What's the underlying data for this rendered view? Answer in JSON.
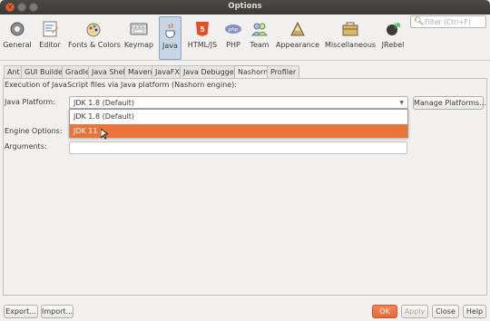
{
  "window": {
    "title": "Options"
  },
  "search": {
    "placeholder": "Filter (Ctrl+F)"
  },
  "categories": [
    {
      "label": "General",
      "icon": "general-icon"
    },
    {
      "label": "Editor",
      "icon": "editor-icon"
    },
    {
      "label": "Fonts & Colors",
      "icon": "fonts-colors-icon"
    },
    {
      "label": "Keymap",
      "icon": "keymap-icon"
    },
    {
      "label": "Java",
      "icon": "java-icon"
    },
    {
      "label": "HTML/JS",
      "icon": "html5-icon"
    },
    {
      "label": "PHP",
      "icon": "php-icon"
    },
    {
      "label": "Team",
      "icon": "team-icon"
    },
    {
      "label": "Appearance",
      "icon": "appearance-icon"
    },
    {
      "label": "Miscellaneous",
      "icon": "miscellaneous-icon"
    },
    {
      "label": "JRebel",
      "icon": "jrebel-icon"
    }
  ],
  "tabs": [
    "Ant",
    "GUI Builder",
    "Gradle",
    "Java Shell",
    "Maven",
    "JavaFX",
    "Java Debugger",
    "Nashorn",
    "Profiler"
  ],
  "panel": {
    "description": "Execution of JavaScript files via Java platform (Nashorn engine):",
    "java_platform_label": "Java Platform:",
    "java_platform_value": "JDK 1.8 (Default)",
    "manage_platforms": "Manage Platforms...",
    "engine_options_label": "Engine Options:",
    "arguments_label": "Arguments:",
    "dropdown_options": [
      "JDK 1.8 (Default)",
      "JDK 11"
    ]
  },
  "footer": {
    "export": "Export...",
    "import": "Import...",
    "ok": "OK",
    "apply": "Apply",
    "close": "Close",
    "help": "Help"
  }
}
